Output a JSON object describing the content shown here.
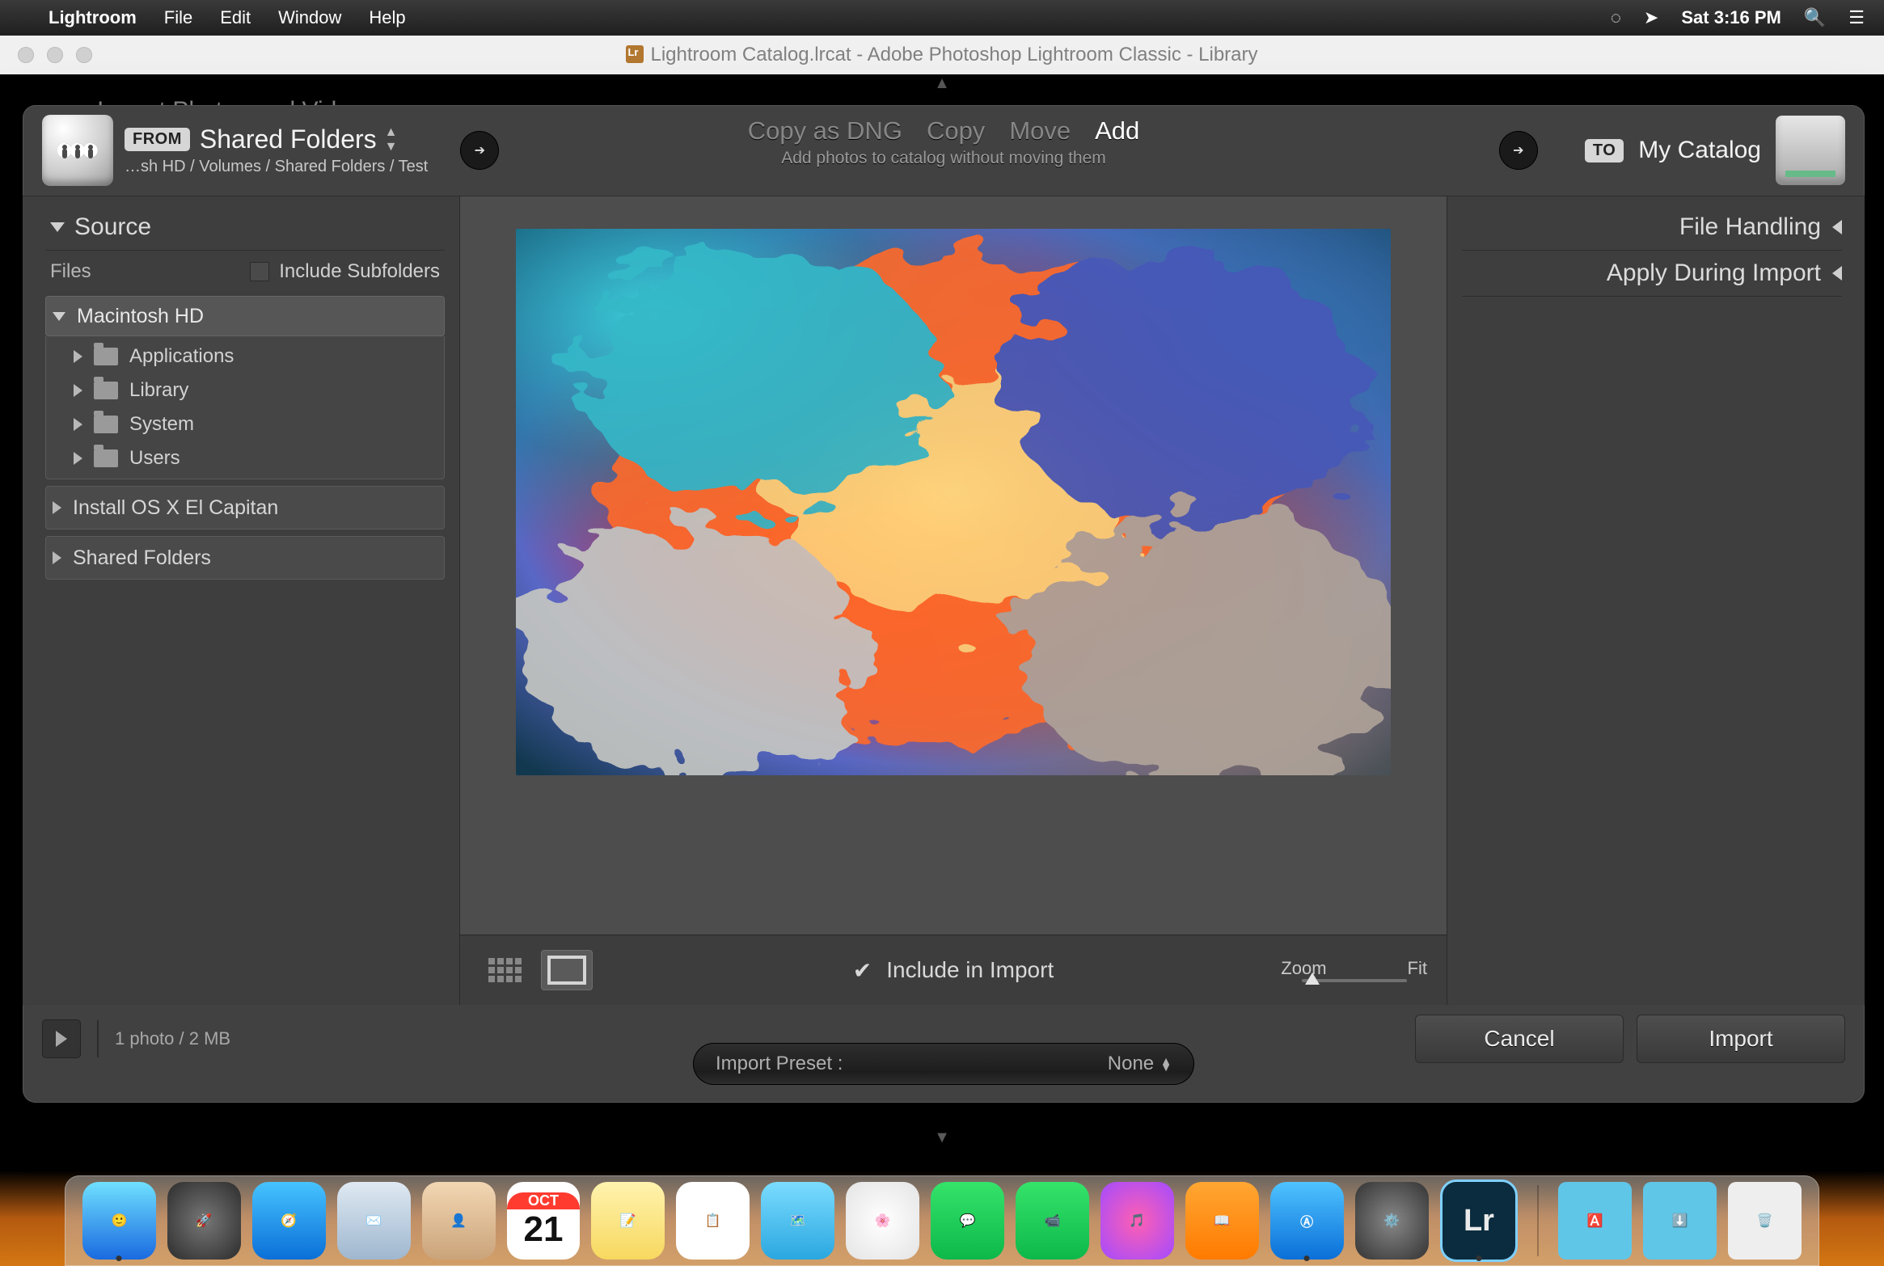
{
  "menubar": {
    "app": "Lightroom",
    "items": [
      "File",
      "Edit",
      "Window",
      "Help"
    ],
    "clock": "Sat 3:16 PM"
  },
  "window": {
    "title": "Lightroom Catalog.lrcat - Adobe Photoshop Lightroom Classic - Library"
  },
  "module_peek": "Import Photos and Videos",
  "header": {
    "from_label": "FROM",
    "from_name": "Shared Folders",
    "from_path": "…sh HD / Volumes / Shared Folders / Test",
    "actions": {
      "copy_dng": "Copy as DNG",
      "copy": "Copy",
      "move": "Move",
      "add": "Add",
      "subtitle": "Add photos to catalog without moving them"
    },
    "to_label": "TO",
    "to_name": "My Catalog"
  },
  "left": {
    "source_title": "Source",
    "files_label": "Files",
    "include_subfolders": "Include Subfolders",
    "tree": {
      "root": "Macintosh HD",
      "children": [
        "Applications",
        "Library",
        "System",
        "Users"
      ],
      "others": [
        "Install OS X El Capitan",
        "Shared Folders"
      ]
    }
  },
  "right": {
    "file_handling": "File Handling",
    "apply_during": "Apply During Import"
  },
  "toolbar": {
    "include_in_import": "Include in Import",
    "zoom": "Zoom",
    "fit": "Fit"
  },
  "footer": {
    "count": "1 photo / 2 MB",
    "preset_label": "Import Preset :",
    "preset_value": "None",
    "cancel": "Cancel",
    "import": "Import"
  },
  "dock": {
    "date": "21",
    "month": "OCT"
  }
}
